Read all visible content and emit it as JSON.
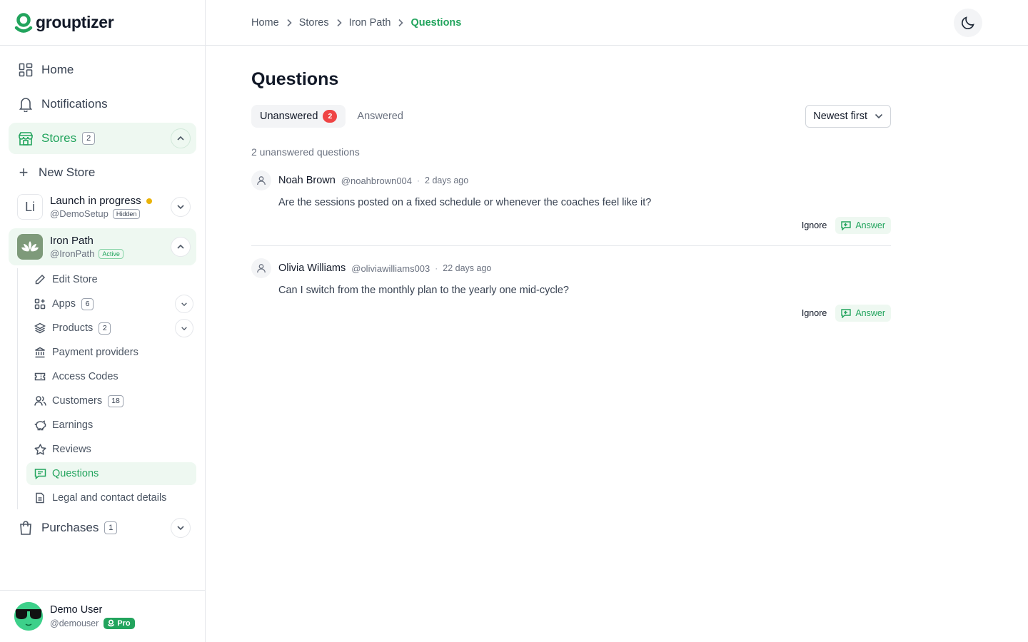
{
  "brand": {
    "name": "grouptizer"
  },
  "sidebar": {
    "home": "Home",
    "notifications": "Notifications",
    "stores": {
      "label": "Stores",
      "count": "2"
    },
    "new_store": "New Store",
    "store_list": [
      {
        "avatar_text": "Li",
        "name": "Launch in progress",
        "handle": "@DemoSetup",
        "status": "Hidden"
      },
      {
        "avatar_text": "",
        "name": "Iron Path",
        "handle": "@IronPath",
        "status": "Active"
      }
    ],
    "store_menu": {
      "edit": "Edit Store",
      "apps": {
        "label": "Apps",
        "count": "6"
      },
      "products": {
        "label": "Products",
        "count": "2"
      },
      "payment": "Payment providers",
      "access": "Access Codes",
      "customers": {
        "label": "Customers",
        "count": "18"
      },
      "earnings": "Earnings",
      "reviews": "Reviews",
      "questions": "Questions",
      "legal": "Legal and contact details"
    },
    "purchases": {
      "label": "Purchases",
      "count": "1"
    }
  },
  "user": {
    "name": "Demo User",
    "handle": "@demouser",
    "plan": "Pro"
  },
  "breadcrumb": [
    "Home",
    "Stores",
    "Iron Path",
    "Questions"
  ],
  "page": {
    "title": "Questions",
    "tabs": [
      {
        "label": "Unanswered",
        "count": "2"
      },
      {
        "label": "Answered"
      }
    ],
    "sort": "Newest first",
    "summary": "2 unanswered questions",
    "questions": [
      {
        "name": "Noah Brown",
        "handle": "@noahbrown004",
        "time": "2 days ago",
        "text": "Are the sessions posted on a fixed schedule or whenever the coaches feel like it?"
      },
      {
        "name": "Olivia Williams",
        "handle": "@oliviawilliams003",
        "time": "22 days ago",
        "text": "Can I switch from the monthly plan to the yearly one mid-cycle?"
      }
    ],
    "ignore_label": "Ignore",
    "answer_label": "Answer"
  },
  "colors": {
    "accent": "#22a45d",
    "accent_bg": "#eef8f1",
    "danger": "#ef4444",
    "pending": "#eab308"
  }
}
